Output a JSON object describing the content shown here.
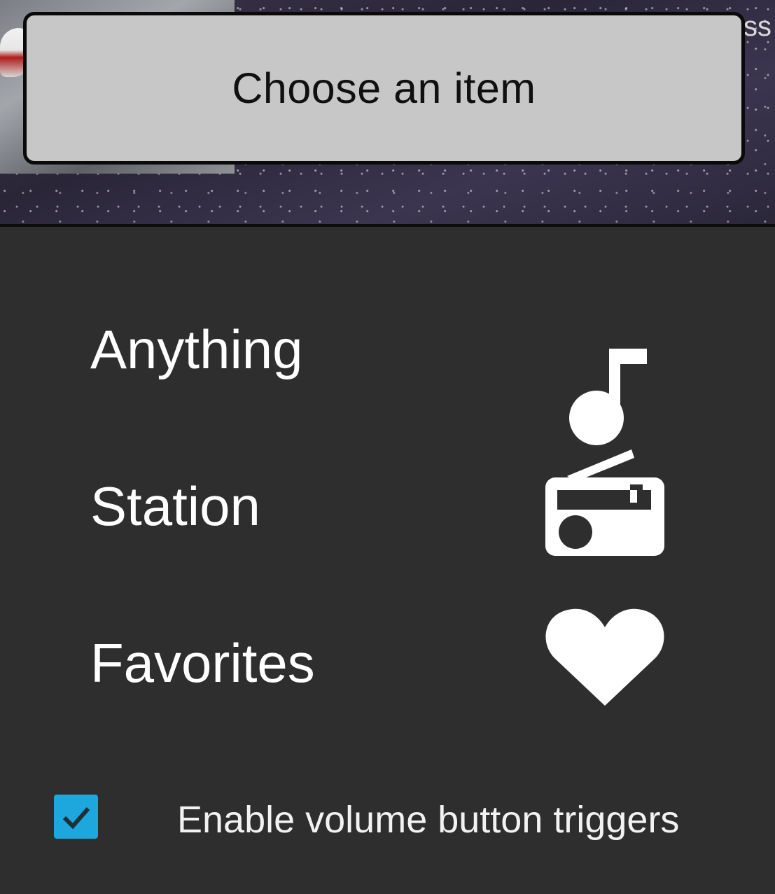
{
  "dialog": {
    "title": "Choose an item"
  },
  "options": [
    {
      "label": "Anything",
      "icon": "music-note-icon"
    },
    {
      "label": "Station",
      "icon": "radio-icon"
    },
    {
      "label": "Favorites",
      "icon": "heart-icon"
    }
  ],
  "volume_trigger": {
    "label": "Enable volume button triggers",
    "checked": true,
    "check_color": "#1ea7dd"
  },
  "background": {
    "edge_text": "ss"
  }
}
